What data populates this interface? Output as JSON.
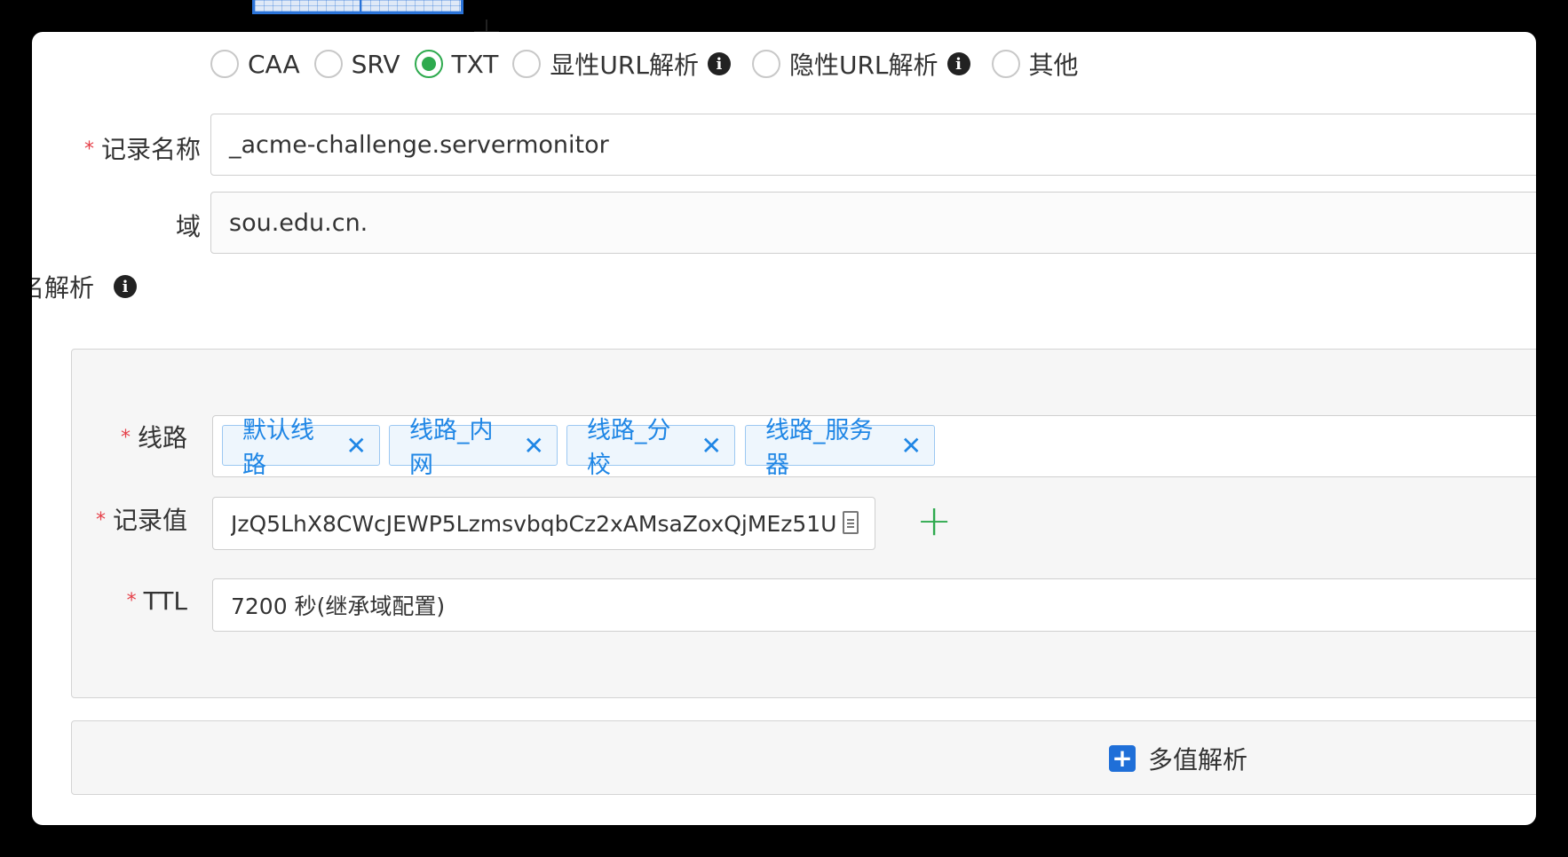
{
  "record_types": [
    {
      "label": "CAA",
      "checked": false,
      "info": false
    },
    {
      "label": "SRV",
      "checked": false,
      "info": false
    },
    {
      "label": "TXT",
      "checked": true,
      "info": false
    },
    {
      "label": "显性URL解析",
      "checked": false,
      "info": true
    },
    {
      "label": "隐性URL解析",
      "checked": false,
      "info": true
    },
    {
      "label": "其他",
      "checked": false,
      "info": false
    }
  ],
  "record_name": {
    "label": "记录名称",
    "value": "_acme-challenge.servermonitor"
  },
  "domain": {
    "label": "域",
    "value": "sou.edu.cn."
  },
  "section_label": "名解析",
  "route": {
    "label": "线路",
    "tags": [
      "默认线路",
      "线路_内网",
      "线路_分校",
      "线路_服务器"
    ],
    "remove_glyph": "✕"
  },
  "record_value": {
    "label": "记录值",
    "value": "JzQ5LhX8CWcJEWP5LzmsvbqbCz2xAMsaZoxQjMEz51U"
  },
  "ttl": {
    "label": "TTL",
    "value": "7200 秒(继承域配置)"
  },
  "add_value_glyph": "+",
  "multi_value": {
    "label": "多值解析",
    "glyph": "+"
  },
  "info_glyph": "i",
  "required_mark": "*",
  "colors": {
    "accent_green": "#2eaa4e",
    "tag_blue": "#1f86e5",
    "button_blue": "#1f6fd8",
    "required_red": "#e5414a"
  }
}
